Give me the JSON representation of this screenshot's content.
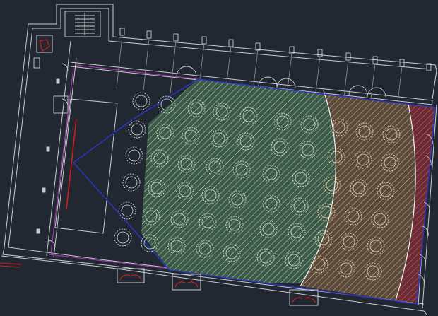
{
  "canvas": {
    "background": "#222831"
  },
  "colors": {
    "wall": "#c9ccd0",
    "wall_dim": "#8f949b",
    "boundary_blue": "#2a36c8",
    "magenta": "#b23ac0",
    "red_accent": "#d81e1e",
    "zone_green_fill": "#3d5a48",
    "zone_green_hatch": "#b9d6bf",
    "zone_brown_fill": "#5a4a3b",
    "zone_brown_hatch": "#d8b48e",
    "zone_red_fill": "#6a2b34",
    "zone_red_hatch": "#c86a74",
    "table_green": "#c8dcc8",
    "table_brown": "#e8d0b0",
    "table_white": "#d8dadd"
  },
  "zones": [
    {
      "name": "green-zone",
      "color": "zone_green_fill"
    },
    {
      "name": "brown-zone",
      "color": "zone_brown_fill"
    },
    {
      "name": "red-zone",
      "color": "zone_red_fill"
    }
  ],
  "icons": {
    "stair": "staircase-icon",
    "door": "door-swing-icon",
    "table": "round-table-icon",
    "stage": "stage-platform-icon"
  }
}
